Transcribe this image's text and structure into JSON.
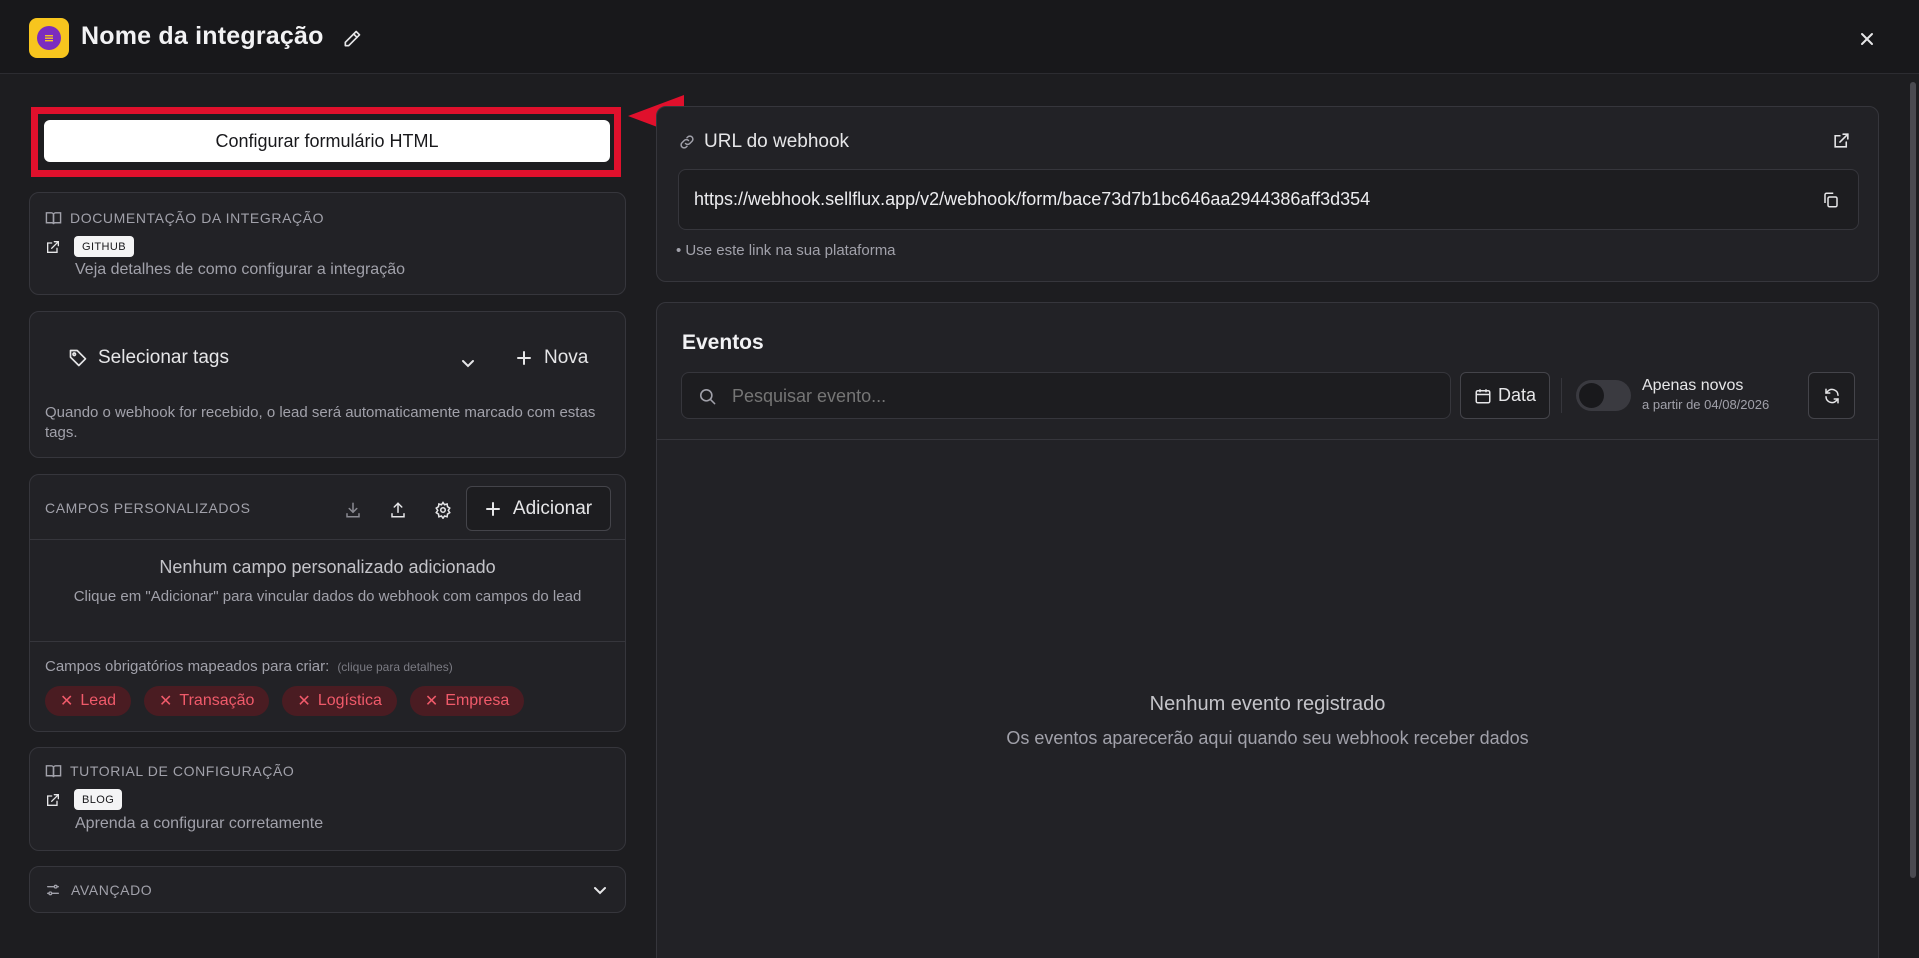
{
  "header": {
    "title": "Nome da integração"
  },
  "config": {
    "button_label": "Configurar formulário HTML"
  },
  "docs": {
    "heading": "DOCUMENTAÇÃO DA INTEGRAÇÃO",
    "badge": "GITHUB",
    "description": "Veja detalhes de como configurar a integração"
  },
  "tags": {
    "select_label": "Selecionar tags",
    "new_label": "Nova",
    "help": "Quando o webhook for recebido, o lead será automaticamente marcado com estas tags."
  },
  "custom_fields": {
    "heading": "CAMPOS PERSONALIZADOS",
    "add_label": "Adicionar",
    "empty_title": "Nenhum campo personalizado adicionado",
    "empty_text": "Clique em \"Adicionar\" para vincular dados do webhook com campos do lead",
    "required_label": "Campos obrigatórios mapeados para criar:",
    "required_hint": "(clique para detalhes)",
    "required_items": [
      "Lead",
      "Transação",
      "Logística",
      "Empresa"
    ]
  },
  "tutorial": {
    "heading": "TUTORIAL DE CONFIGURAÇÃO",
    "badge": "BLOG",
    "description": "Aprenda a configurar corretamente"
  },
  "advanced": {
    "label": "AVANÇADO"
  },
  "webhook": {
    "title": "URL do webhook",
    "url": "https://webhook.sellflux.app/v2/webhook/form/bace73d7b1bc646aa2944386aff3d354",
    "hint": "• Use este link na sua plataforma"
  },
  "events": {
    "title": "Eventos",
    "search_placeholder": "Pesquisar evento...",
    "date_label": "Data",
    "only_new_label": "Apenas novos",
    "only_new_since": "a partir de 04/08/2026",
    "empty_title": "Nenhum evento registrado",
    "empty_text": "Os eventos aparecerão aqui quando seu webhook receber dados"
  },
  "colors": {
    "accent_red": "#e0102c",
    "background": "#1d1d20",
    "card": "#222226",
    "logo_yellow": "#f7c51e",
    "logo_purple": "#7b2cbf"
  }
}
